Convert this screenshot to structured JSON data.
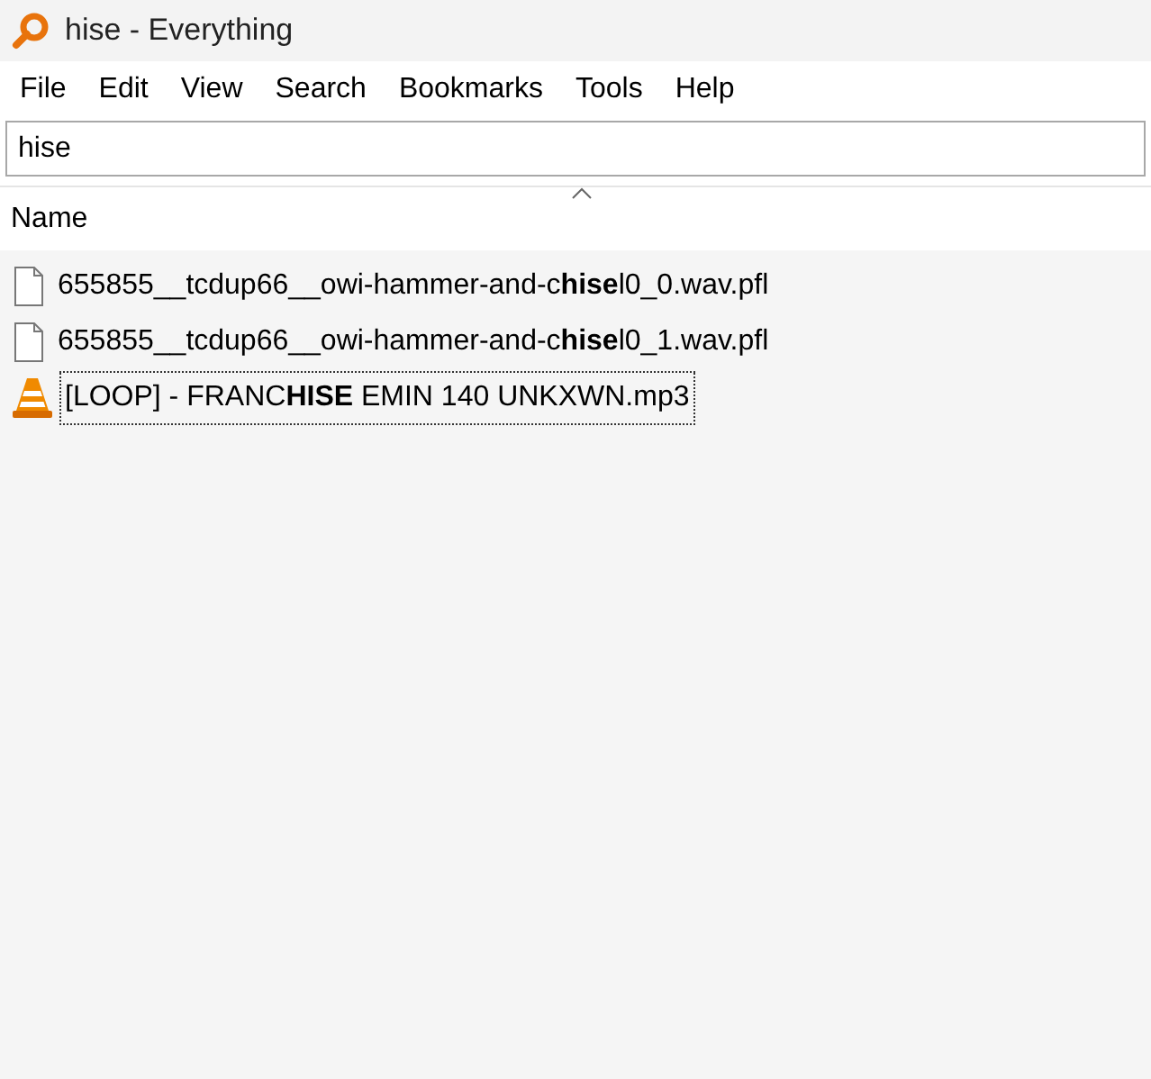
{
  "window": {
    "title": "hise - Everything"
  },
  "menu": [
    "File",
    "Edit",
    "View",
    "Search",
    "Bookmarks",
    "Tools",
    "Help"
  ],
  "search": {
    "value": "hise"
  },
  "table": {
    "columns": [
      "Name"
    ],
    "rows": [
      {
        "kind": "file",
        "name": "655855__tcdup66__owi-hammer-and-c**hise**l0_0.wav.pfl",
        "focused": false
      },
      {
        "kind": "file",
        "name": "655855__tcdup66__owi-hammer-and-c**hise**l0_1.wav.pfl",
        "focused": false
      },
      {
        "kind": "media",
        "name": "[LOOP] - FRANC**HISE** EMIN 140 UNKXWN.mp3",
        "focused": true
      }
    ]
  }
}
